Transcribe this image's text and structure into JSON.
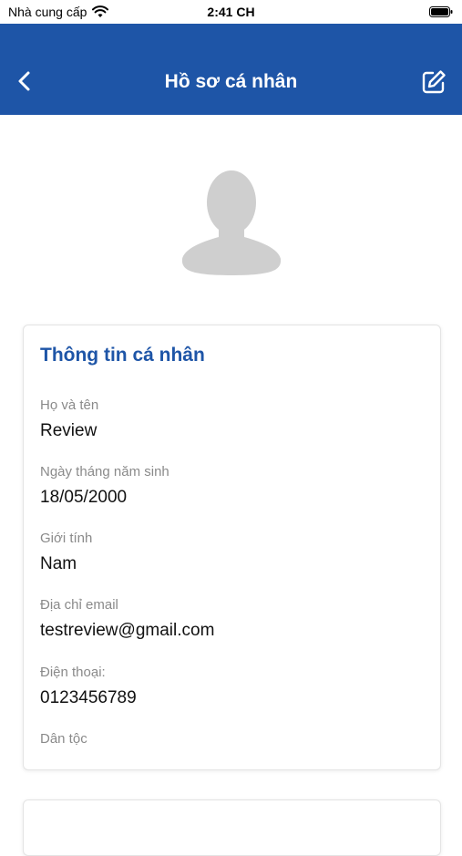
{
  "status_bar": {
    "carrier": "Nhà cung cấp",
    "time": "2:41 CH"
  },
  "header": {
    "title": "Hồ sơ cá nhân",
    "back_icon": "chevron-left-icon",
    "edit_icon": "edit-icon"
  },
  "colors": {
    "header_bg": "#1e55a7",
    "accent": "#1e55a7"
  },
  "profile": {
    "section_title": "Thông tin cá nhân",
    "fields": [
      {
        "label": "Họ và tên",
        "value": "Review"
      },
      {
        "label": "Ngày tháng năm sinh",
        "value": "18/05/2000"
      },
      {
        "label": "Giới tính",
        "value": "Nam"
      },
      {
        "label": "Địa chỉ email",
        "value": "testreview@gmail.com"
      },
      {
        "label": "Điện thoại:",
        "value": "0123456789"
      },
      {
        "label": "Dân tộc",
        "value": ""
      }
    ]
  }
}
